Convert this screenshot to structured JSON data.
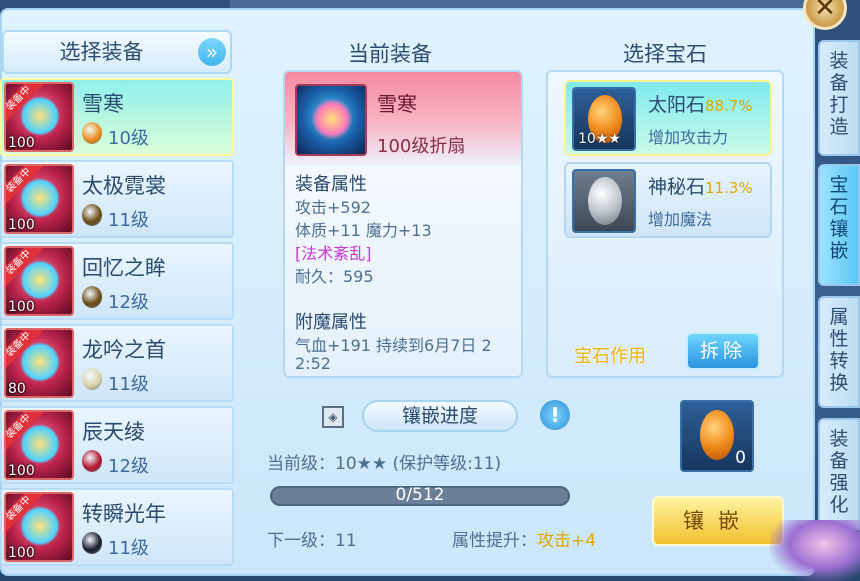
{
  "left_panel": {
    "header": "选择装备",
    "items": [
      {
        "name": "雪寒",
        "level": "100",
        "gem_level": "10级",
        "gem_color": "#f08a1d",
        "badge": "装备中",
        "selected": true
      },
      {
        "name": "太极霓裳",
        "level": "100",
        "gem_level": "11级",
        "gem_color": "#6b4a12",
        "badge": "装备中",
        "selected": false
      },
      {
        "name": "回忆之眸",
        "level": "100",
        "gem_level": "12级",
        "gem_color": "#6b4a12",
        "badge": "装备中",
        "selected": false
      },
      {
        "name": "龙吟之首",
        "level": "80",
        "gem_level": "11级",
        "gem_color": "#d9d3a6",
        "badge": "装备中",
        "selected": false
      },
      {
        "name": "辰天绫",
        "level": "100",
        "gem_level": "12级",
        "gem_color": "#b3122c",
        "badge": "装备中",
        "selected": false
      },
      {
        "name": "转瞬光年",
        "level": "100",
        "gem_level": "11级",
        "gem_color": "#1a1a2a",
        "badge": "装备中",
        "selected": false
      }
    ]
  },
  "center_panel": {
    "title": "当前装备",
    "item_name": "雪寒",
    "item_sub": "100级折扇",
    "attr_header": "装备属性",
    "attrs": [
      "攻击+592",
      "体质+11 魔力+13"
    ],
    "magic": "[法术紊乱]",
    "durability": "耐久：595",
    "enchant_header": "附魔属性",
    "enchant_line1": "气血+191 持续到6月7日 2",
    "enchant_line2": "2:52"
  },
  "right_panel": {
    "title": "选择宝石",
    "gems": [
      {
        "name": "太阳石",
        "pct": "88.7%",
        "desc": "增加攻击力",
        "stars": "10★★",
        "selected": true
      },
      {
        "name": "神秘石",
        "pct": "11.3%",
        "desc": "增加魔法",
        "stars": "",
        "selected": false
      }
    ],
    "effect_label": "宝石作用",
    "remove_label": "拆除"
  },
  "progress": {
    "label": "镶嵌进度",
    "current_level": "当前级：10★★ (保护等级:11)",
    "bar_text": "0/512",
    "fill": 0,
    "next_level": "下一级：11",
    "attr_up_label": "属性提升：",
    "attr_up_value": "攻击+4"
  },
  "slot": {
    "count": "0"
  },
  "inlay_button": "镶嵌",
  "tabs": [
    {
      "label": "装备打造",
      "active": false
    },
    {
      "label": "宝石镶嵌",
      "active": true
    },
    {
      "label": "属性转换",
      "active": false
    },
    {
      "label": "装备强化",
      "active": false
    }
  ],
  "icons": {
    "close": "close-icon",
    "arrow": "double-chevron-right-icon",
    "info": "info-icon"
  }
}
